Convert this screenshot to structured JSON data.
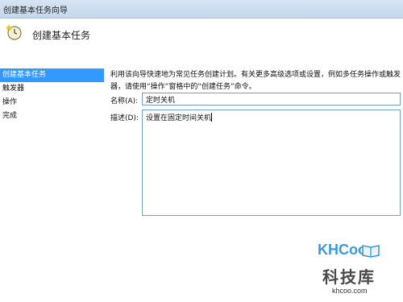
{
  "window": {
    "title": "创建基本任务向导"
  },
  "header": {
    "heading": "创建基本任务"
  },
  "nav": {
    "items": [
      {
        "label": "创建基本任务",
        "active": true
      },
      {
        "label": "触发器",
        "active": false
      },
      {
        "label": "操作",
        "active": false
      },
      {
        "label": "完成",
        "active": false
      }
    ]
  },
  "form": {
    "intro_line1": "利用该向导快速地为常见任务创建计划。有关更多高级选项或设置，例如多任务操作或触发",
    "intro_line2": "器，请使用“操作”窗格中的“创建任务”命令。",
    "name_label": "名称(A):",
    "name_value": "定时关机",
    "description_label": "描述(D):",
    "description_value": "设置在固定时间关机"
  },
  "watermark": {
    "logo_text": "KHCoo",
    "site_name": "科技库",
    "url": "khcoo.com"
  },
  "colors": {
    "nav_active": "#3399ff",
    "titlebar": "#c4d7ec",
    "logo": "#3a9ad9"
  }
}
